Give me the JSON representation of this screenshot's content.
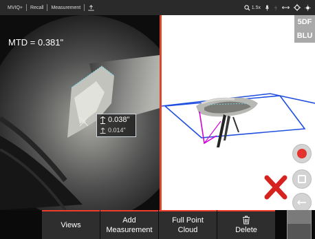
{
  "topbar": {
    "crumbs": [
      "MVIQ+",
      "Recall",
      "Measurement"
    ],
    "zoom": "1.5x",
    "icons": [
      "upload-icon",
      "zoom-icon",
      "microphone-icon",
      "lightning-icon",
      "swap-arrows-icon",
      "crosshair-icon",
      "sun-icon"
    ]
  },
  "camera": {
    "mtd_label": "MTD = 0.381\"",
    "measurement": {
      "depth": "0.038\"",
      "secondary": "0.014\""
    }
  },
  "cloud": {
    "badge_top": "5DF",
    "badge_bottom": "BLU"
  },
  "colors": {
    "accent": "#f03d2a",
    "divider": "#e0442a",
    "plane_blue": "#1f4fe0",
    "vector_magenta": "#d000d8",
    "measure_cyan": "#6ee0ee"
  },
  "toolbar": {
    "views": "Views",
    "add_line1": "Add",
    "add_line2": "Measurement",
    "cloud_line1": "Full Point",
    "cloud_line2": "Cloud",
    "delete": "Delete"
  }
}
